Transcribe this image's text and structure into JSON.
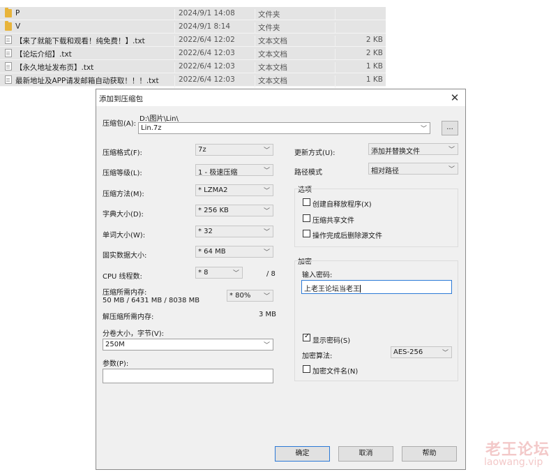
{
  "files": [
    {
      "name": "P",
      "date": "2024/9/1 14:08",
      "type": "文件夹",
      "size": "",
      "icon": "folder-icon"
    },
    {
      "name": "V",
      "date": "2024/9/1 8:14",
      "type": "文件夹",
      "size": "",
      "icon": "folder-icon"
    },
    {
      "name": "【来了就能下载和观看！纯免费！】.txt",
      "date": "2022/6/4 12:02",
      "type": "文本文档",
      "size": "2 KB",
      "icon": "txt-icon"
    },
    {
      "name": "【论坛介绍】.txt",
      "date": "2022/6/4 12:03",
      "type": "文本文档",
      "size": "2 KB",
      "icon": "txt-icon"
    },
    {
      "name": "【永久地址发布页】.txt",
      "date": "2022/6/4 12:03",
      "type": "文本文档",
      "size": "1 KB",
      "icon": "txt-icon"
    },
    {
      "name": "最新地址及APP请发邮箱自动获取！！！.txt",
      "date": "2022/6/4 12:03",
      "type": "文本文档",
      "size": "1 KB",
      "icon": "txt-icon"
    }
  ],
  "dialog": {
    "title": "添加到压缩包",
    "close": "✕",
    "archive_label": "压缩包(A):",
    "archive_path": "D:\\图片\\Lin\\",
    "archive_name": "Lin.7z",
    "browse_label": "...",
    "format_label": "压缩格式(F):",
    "format_value": "7z",
    "level_label": "压缩等级(L):",
    "level_value": "1 - 极速压缩",
    "method_label": "压缩方法(M):",
    "method_value": "* LZMA2",
    "dict_label": "字典大小(D):",
    "dict_value": "* 256 KB",
    "word_label": "单词大小(W):",
    "word_value": "* 32",
    "solid_label": "固实数据大小:",
    "solid_value": "* 64 MB",
    "threads_label": "CPU 线程数:",
    "threads_value": "* 8",
    "threads_total": "/ 8",
    "mem_comp_label": "压缩所需内存:",
    "mem_comp_detail": "50 MB / 6431 MB / 8038 MB",
    "mem_percent": "* 80%",
    "mem_decomp_label": "解压缩所需内存:",
    "mem_decomp_value": "3 MB",
    "split_label": "分卷大小，字节(V):",
    "split_value": "250M",
    "params_label": "参数(P):",
    "params_value": "",
    "update_label": "更新方式(U):",
    "update_value": "添加并替换文件",
    "pathmode_label": "路径模式",
    "pathmode_value": "相对路径",
    "options_title": "选项",
    "opt_sfx": "创建自释放程序(X)",
    "opt_shared": "压缩共享文件",
    "opt_delete": "操作完成后删除源文件",
    "encrypt_title": "加密",
    "password_label": "输入密码:",
    "password_value": "上老王论坛当老王",
    "show_password": "显示密码(S)",
    "enc_method_label": "加密算法:",
    "enc_method_value": "AES-256",
    "enc_names": "加密文件名(N)",
    "ok": "确定",
    "cancel": "取消",
    "help": "帮助"
  },
  "watermark": {
    "cn": "老王论坛",
    "url": "laowang.vip"
  }
}
